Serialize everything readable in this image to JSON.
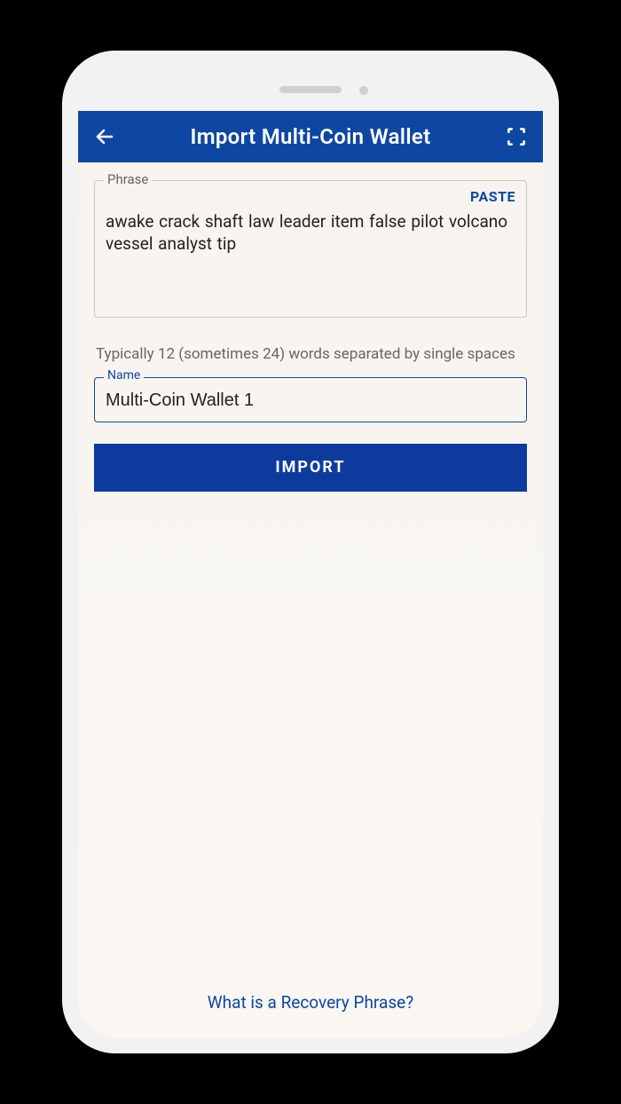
{
  "appbar": {
    "title": "Import Multi-Coin Wallet"
  },
  "phrase": {
    "label": "Phrase",
    "paste_label": "PASTE",
    "value": "awake crack shaft law leader item false pilot volcano vessel analyst tip"
  },
  "hint": "Typically 12 (sometimes 24) words separated by single spaces",
  "name": {
    "label": "Name",
    "value": "Multi-Coin Wallet 1"
  },
  "import_button": "IMPORT",
  "footer_link": "What is a Recovery Phrase?",
  "colors": {
    "primary": "#0d47a1",
    "background": "#f7f4f0"
  }
}
